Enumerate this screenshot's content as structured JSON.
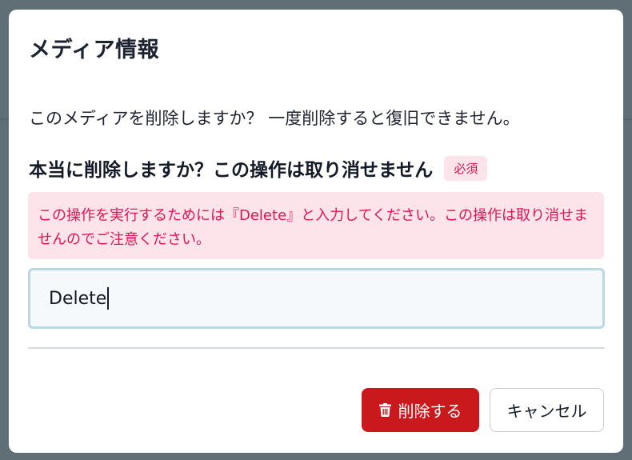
{
  "dialog": {
    "title": "メディア情報",
    "description": "このメディアを削除しますか？ 一度削除すると復旧できません。",
    "field": {
      "label": "本当に削除しますか？この操作は取り消せません",
      "required_badge": "必須",
      "hint": "この操作を実行するためには『Delete』と入力してください。この操作は取り消せませんのでご注意ください。",
      "value": "Delete"
    },
    "buttons": {
      "delete_label": "削除する",
      "delete_icon": "trash-icon",
      "cancel_label": "キャンセル"
    }
  },
  "colors": {
    "danger": "#c9191c",
    "alert_bg": "#fde3ea",
    "alert_text": "#e11553",
    "input_border": "#bcd7e4",
    "backdrop": "#5f6f75"
  }
}
